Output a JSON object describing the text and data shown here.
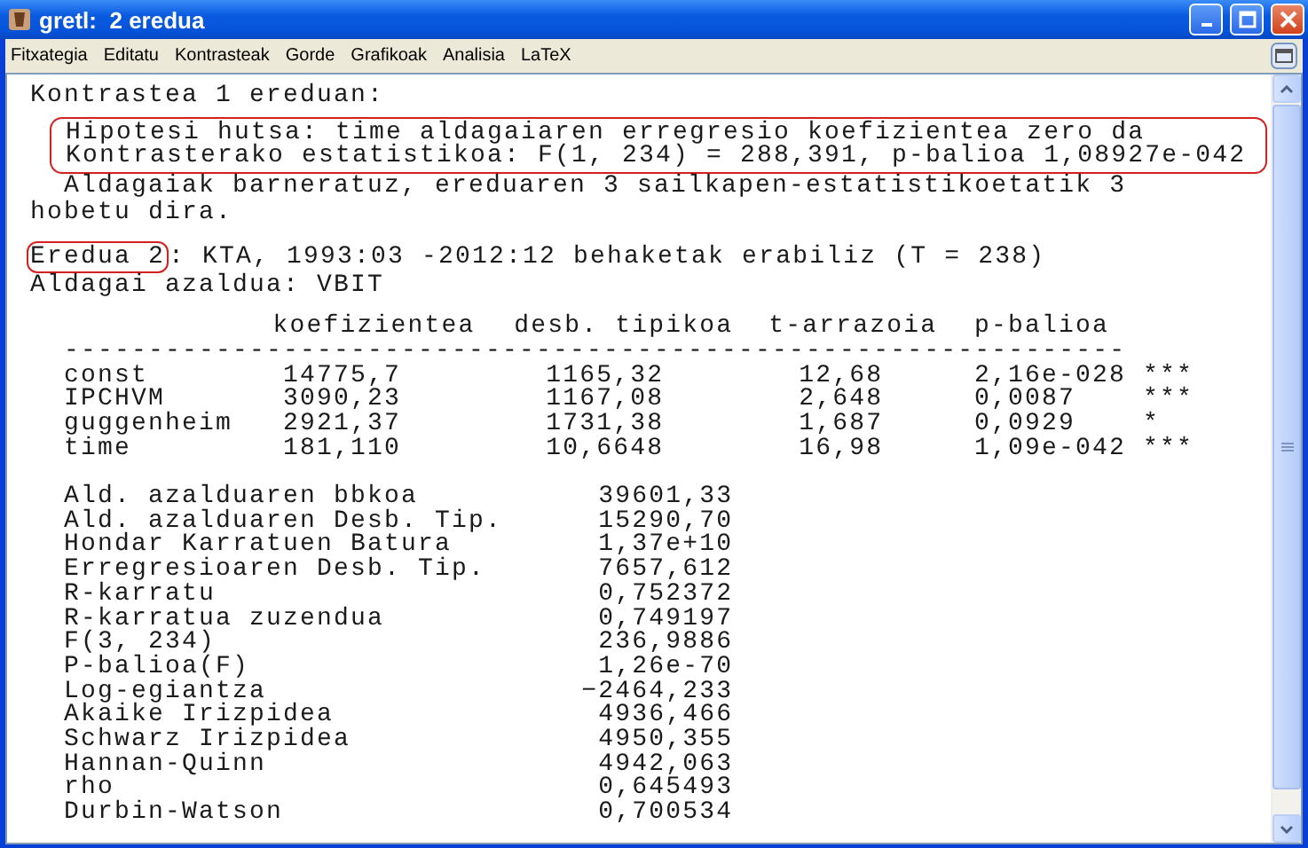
{
  "window": {
    "title": "gretl:  2 eredua"
  },
  "menu": [
    "Fitxategia",
    "Editatu",
    "Kontrasteak",
    "Gorde",
    "Grafikoak",
    "Analisia",
    "LaTeX"
  ],
  "output": {
    "heading": "Kontrastea 1 ereduan:",
    "test_result": [
      {
        "text": "Hipotesi hutsa: time aldagaiaren erregresio koefizientea zero da",
        "highlighted": true
      },
      {
        "text": "Kontrasterako estatistikoa: F(1, 234) = 288,391, p-balioa 1,08927e-042",
        "highlighted": true
      }
    ],
    "note": "Aldagaiak barneratuz, ereduaren 3 sailkapen-estatistikoetatik 3 hobetu dira.",
    "model": {
      "label": "Eredua 2",
      "highlighted": true,
      "description": ": KTA, 1993:03 -2012:12 behaketak erabiliz (T = 238)"
    },
    "dependent": "Aldagai azaldua: VBIT",
    "coefficients": {
      "columns": [
        "koefizientea",
        "desb. tipikoa",
        "t-arrazoia",
        "p-balioa"
      ],
      "separator": "---------------------------------------------------------------",
      "rows": [
        {
          "name": "const",
          "coef": "14775,7",
          "se": "1165,32",
          "t": "12,68",
          "p": "2,16e-028",
          "stars": "***"
        },
        {
          "name": "IPCHVM",
          "coef": "3090,23",
          "se": "1167,08",
          "t": "2,648",
          "p": "0,0087",
          "stars": "***"
        },
        {
          "name": "guggenheim",
          "coef": "2921,37",
          "se": "1731,38",
          "t": "1,687",
          "p": "0,0929",
          "stars": "*"
        },
        {
          "name": "time",
          "coef": "181,110",
          "se": "10,6648",
          "t": "16,98",
          "p": "1,09e-042",
          "stars": "***"
        }
      ]
    },
    "statistics": [
      {
        "label": "Ald. azalduaren bbkoa",
        "value": "39601,33"
      },
      {
        "label": "Ald. azalduaren Desb. Tip.",
        "value": "15290,70"
      },
      {
        "label": "Hondar Karratuen Batura",
        "value": "1,37e+10"
      },
      {
        "label": "Erregresioaren Desb. Tip.",
        "value": "7657,612"
      },
      {
        "label": "R-karratu",
        "value": "0,752372"
      },
      {
        "label": "R-karratua zuzendua",
        "value": "0,749197"
      },
      {
        "label": "F(3, 234)",
        "value": "236,9886"
      },
      {
        "label": "P-balioa(F)",
        "value": "1,26e-70"
      },
      {
        "label": "Log-egiantza",
        "value": "−2464,233"
      },
      {
        "label": "Akaike Irizpidea",
        "value": "4936,466"
      },
      {
        "label": "Schwarz Irizpidea",
        "value": "4950,355"
      },
      {
        "label": "Hannan-Quinn",
        "value": "4942,063"
      },
      {
        "label": "rho",
        "value": "0,645493"
      },
      {
        "label": "Durbin-Watson",
        "value": "0,700534"
      }
    ]
  }
}
